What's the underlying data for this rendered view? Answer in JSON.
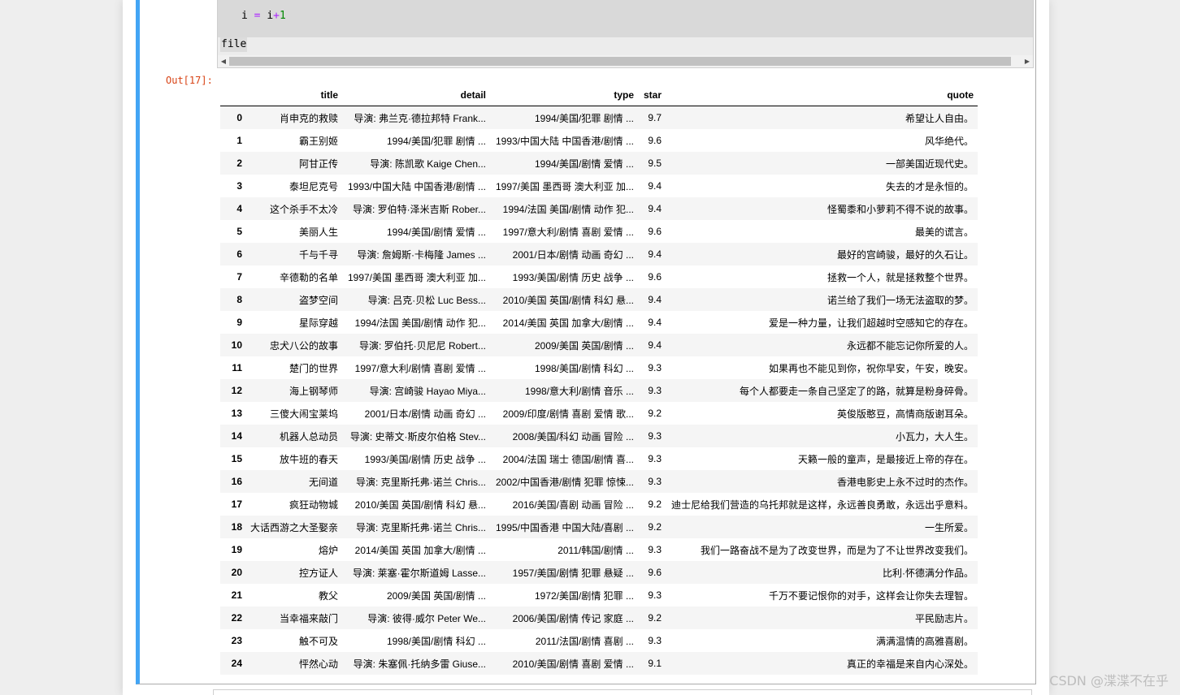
{
  "colors": {
    "cell_selected_border": "#42a5f5",
    "out_prompt": "#d84315",
    "code_operator": "#aa22ff",
    "code_number": "#008800"
  },
  "code": {
    "var": "i",
    "assign": "=",
    "expr_var": "i",
    "plus": "+",
    "number": "1"
  },
  "stdout": "file",
  "out_prompt": "Out[17]:",
  "table": {
    "columns": [
      "title",
      "detail",
      "type",
      "star",
      "quote"
    ],
    "rows": [
      {
        "index": "0",
        "title": "肖申克的救赎",
        "detail": "导演: 弗兰克·德拉邦特 Frank...",
        "type": "1994/美国/犯罪 剧情 ...",
        "star": "9.7",
        "quote": "希望让人自由。"
      },
      {
        "index": "1",
        "title": "霸王别姬",
        "detail": "1994/美国/犯罪 剧情 ...",
        "type": "1993/中国大陆 中国香港/剧情 ...",
        "star": "9.6",
        "quote": "风华绝代。"
      },
      {
        "index": "2",
        "title": "阿甘正传",
        "detail": "导演: 陈凯歌 Kaige Chen...",
        "type": "1994/美国/剧情 爱情 ...",
        "star": "9.5",
        "quote": "一部美国近现代史。"
      },
      {
        "index": "3",
        "title": "泰坦尼克号",
        "detail": "1993/中国大陆 中国香港/剧情 ...",
        "type": "1997/美国 墨西哥 澳大利亚 加...",
        "star": "9.4",
        "quote": "失去的才是永恒的。"
      },
      {
        "index": "4",
        "title": "这个杀手不太冷",
        "detail": "导演: 罗伯特·泽米吉斯 Rober...",
        "type": "1994/法国 美国/剧情 动作 犯...",
        "star": "9.4",
        "quote": "怪蜀黍和小萝莉不得不说的故事。"
      },
      {
        "index": "5",
        "title": "美丽人生",
        "detail": "1994/美国/剧情 爱情 ...",
        "type": "1997/意大利/剧情 喜剧 爱情 ...",
        "star": "9.6",
        "quote": "最美的谎言。"
      },
      {
        "index": "6",
        "title": "千与千寻",
        "detail": "导演: 詹姆斯·卡梅隆 James ...",
        "type": "2001/日本/剧情 动画 奇幻 ...",
        "star": "9.4",
        "quote": "最好的宫崎骏，最好的久石让。"
      },
      {
        "index": "7",
        "title": "辛德勒的名单",
        "detail": "1997/美国 墨西哥 澳大利亚 加...",
        "type": "1993/美国/剧情 历史 战争 ...",
        "star": "9.6",
        "quote": "拯救一个人，就是拯救整个世界。"
      },
      {
        "index": "8",
        "title": "盗梦空间",
        "detail": "导演: 吕克·贝松 Luc Bess...",
        "type": "2010/美国 英国/剧情 科幻 悬...",
        "star": "9.4",
        "quote": "诺兰给了我们一场无法盗取的梦。"
      },
      {
        "index": "9",
        "title": "星际穿越",
        "detail": "1994/法国 美国/剧情 动作 犯...",
        "type": "2014/美国 英国 加拿大/剧情 ...",
        "star": "9.4",
        "quote": "爱是一种力量，让我们超越时空感知它的存在。"
      },
      {
        "index": "10",
        "title": "忠犬八公的故事",
        "detail": "导演: 罗伯托·贝尼尼 Robert...",
        "type": "2009/美国 英国/剧情 ...",
        "star": "9.4",
        "quote": "永远都不能忘记你所爱的人。"
      },
      {
        "index": "11",
        "title": "楚门的世界",
        "detail": "1997/意大利/剧情 喜剧 爱情 ...",
        "type": "1998/美国/剧情 科幻 ...",
        "star": "9.3",
        "quote": "如果再也不能见到你，祝你早安，午安，晚安。"
      },
      {
        "index": "12",
        "title": "海上钢琴师",
        "detail": "导演: 宫崎骏 Hayao Miya...",
        "type": "1998/意大利/剧情 音乐 ...",
        "star": "9.3",
        "quote": "每个人都要走一条自己坚定了的路，就算是粉身碎骨。"
      },
      {
        "index": "13",
        "title": "三傻大闹宝莱坞",
        "detail": "2001/日本/剧情 动画 奇幻 ...",
        "type": "2009/印度/剧情 喜剧 爱情 歌...",
        "star": "9.2",
        "quote": "英俊版憨豆，高情商版谢耳朵。"
      },
      {
        "index": "14",
        "title": "机器人总动员",
        "detail": "导演: 史蒂文·斯皮尔伯格 Stev...",
        "type": "2008/美国/科幻 动画 冒险 ...",
        "star": "9.3",
        "quote": "小瓦力，大人生。"
      },
      {
        "index": "15",
        "title": "放牛班的春天",
        "detail": "1993/美国/剧情 历史 战争 ...",
        "type": "2004/法国 瑞士 德国/剧情 喜...",
        "star": "9.3",
        "quote": "天籁一般的童声，是最接近上帝的存在。"
      },
      {
        "index": "16",
        "title": "无间道",
        "detail": "导演: 克里斯托弗·诺兰 Chris...",
        "type": "2002/中国香港/剧情 犯罪 惊悚...",
        "star": "9.3",
        "quote": "香港电影史上永不过时的杰作。"
      },
      {
        "index": "17",
        "title": "疯狂动物城",
        "detail": "2010/美国 英国/剧情 科幻 悬...",
        "type": "2016/美国/喜剧 动画 冒险 ...",
        "star": "9.2",
        "quote": "迪士尼给我们营造的乌托邦就是这样，永远善良勇敢，永远出乎意料。"
      },
      {
        "index": "18",
        "title": "大话西游之大圣娶亲",
        "detail": "导演: 克里斯托弗·诺兰 Chris...",
        "type": "1995/中国香港 中国大陆/喜剧 ...",
        "star": "9.2",
        "quote": "一生所爱。"
      },
      {
        "index": "19",
        "title": "熔炉",
        "detail": "2014/美国 英国 加拿大/剧情 ...",
        "type": "2011/韩国/剧情 ...",
        "star": "9.3",
        "quote": "我们一路奋战不是为了改变世界，而是为了不让世界改变我们。"
      },
      {
        "index": "20",
        "title": "控方证人",
        "detail": "导演: 莱塞·霍尔斯道姆 Lasse...",
        "type": "1957/美国/剧情 犯罪 悬疑 ...",
        "star": "9.6",
        "quote": "比利·怀德满分作品。"
      },
      {
        "index": "21",
        "title": "教父",
        "detail": "2009/美国 英国/剧情 ...",
        "type": "1972/美国/剧情 犯罪 ...",
        "star": "9.3",
        "quote": "千万不要记恨你的对手，这样会让你失去理智。"
      },
      {
        "index": "22",
        "title": "当幸福来敲门",
        "detail": "导演: 彼得·威尔 Peter We...",
        "type": "2006/美国/剧情 传记 家庭 ...",
        "star": "9.2",
        "quote": "平民励志片。"
      },
      {
        "index": "23",
        "title": "触不可及",
        "detail": "1998/美国/剧情 科幻 ...",
        "type": "2011/法国/剧情 喜剧 ...",
        "star": "9.3",
        "quote": "满满温情的高雅喜剧。"
      },
      {
        "index": "24",
        "title": "怦然心动",
        "detail": "导演: 朱塞佩·托纳多雷 Giuse...",
        "type": "2010/美国/剧情 喜剧 爱情 ...",
        "star": "9.1",
        "quote": "真正的幸福是来自内心深处。"
      }
    ]
  },
  "scrollbar": {
    "left_arrow": "◀",
    "right_arrow": "▶"
  },
  "watermark": "CSDN @渫渫不在乎"
}
